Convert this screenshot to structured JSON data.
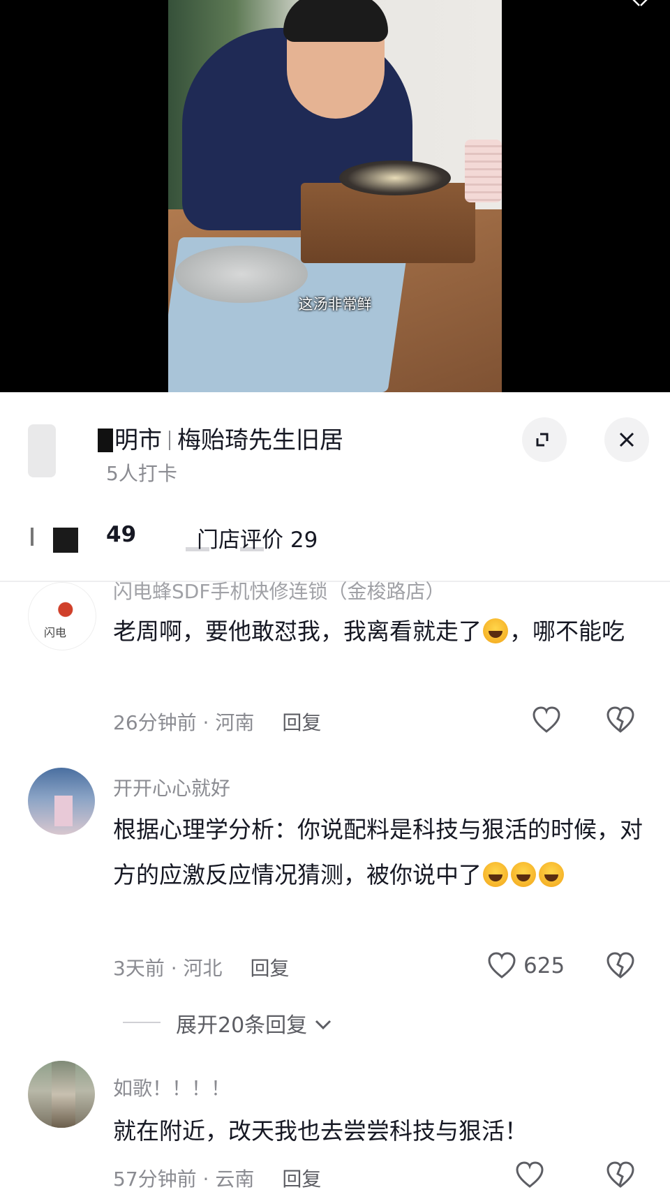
{
  "video": {
    "caption": "这汤非常鲜"
  },
  "location": {
    "title_city": "明市",
    "title_place": "梅贻琦先生旧居",
    "checkins": "5人打卡"
  },
  "rating_bar": {
    "score_fragment": "49",
    "store_reviews_label": "门店评价 29"
  },
  "comments": [
    {
      "username": "闪电蜂SDF手机快修连锁（金梭路店）",
      "text_before_emoji": "老周啊，要他敢怼我，我离看就走了",
      "text_after_emoji": "，哪不能吃",
      "time": "26分钟前 · 河南",
      "reply_label": "回复",
      "likes": ""
    },
    {
      "username": "开开心心就好",
      "text_before_emoji": "根据心理学分析：你说配料是科技与狠活的时候，对方的应激反应情况猜测，被你说中了",
      "text_after_emoji": "",
      "time": "3天前 · 河北",
      "reply_label": "回复",
      "likes": "625",
      "expand_label": "展开20条回复"
    },
    {
      "username": "如歌！！！！",
      "text_before_emoji": "就在附近，改天我也去尝尝科技与狠活！",
      "text_after_emoji": "",
      "time": "57分钟前 · 云南",
      "reply_label": "回复",
      "likes": ""
    }
  ],
  "colors": {
    "primary_text": "#161823",
    "secondary_text": "#8a8b91",
    "sheet_bg": "#ffffff",
    "video_bg": "#000000"
  },
  "icons": [
    "expand-icon",
    "close-icon",
    "heart-icon",
    "broken-heart-icon",
    "chevron-down-icon"
  ]
}
